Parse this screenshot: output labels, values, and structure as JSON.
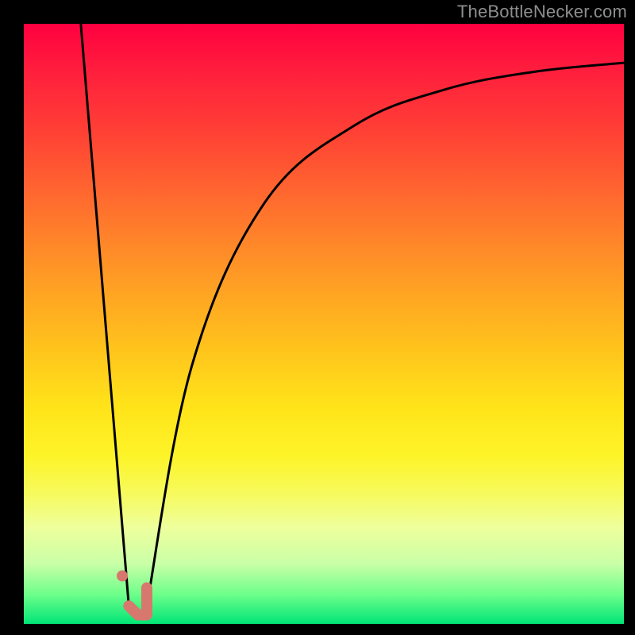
{
  "watermark": "TheBottleNecker.com",
  "chart_data": {
    "type": "line",
    "title": "",
    "xlabel": "",
    "ylabel": "",
    "xlim": [
      0,
      100
    ],
    "ylim": [
      0,
      100
    ],
    "grid": false,
    "series": [
      {
        "name": "left-descent",
        "color": "#000000",
        "width": 3,
        "points": [
          {
            "x": 9.5,
            "y": 100
          },
          {
            "x": 17.5,
            "y": 3
          }
        ]
      },
      {
        "name": "right-curve",
        "color": "#000000",
        "width": 3,
        "points": [
          {
            "x": 20.5,
            "y": 3
          },
          {
            "x": 28,
            "y": 43
          },
          {
            "x": 40,
            "y": 70
          },
          {
            "x": 55,
            "y": 83
          },
          {
            "x": 70,
            "y": 89
          },
          {
            "x": 85,
            "y": 92
          },
          {
            "x": 100,
            "y": 93.5
          }
        ]
      },
      {
        "name": "valley-marker",
        "color": "#d7786e",
        "width": 14,
        "linecap": "round",
        "points": [
          {
            "x": 17.5,
            "y": 3
          },
          {
            "x": 19,
            "y": 1.5
          },
          {
            "x": 20.5,
            "y": 1.5
          },
          {
            "x": 20.5,
            "y": 6
          }
        ]
      },
      {
        "name": "marker-dot",
        "color": "#d7786e",
        "type": "dot",
        "radius": 7,
        "point": {
          "x": 16.4,
          "y": 8
        }
      }
    ],
    "background_gradient": {
      "top": "#ff0040",
      "mid": "#ffe41a",
      "bottom": "#00e577"
    }
  }
}
